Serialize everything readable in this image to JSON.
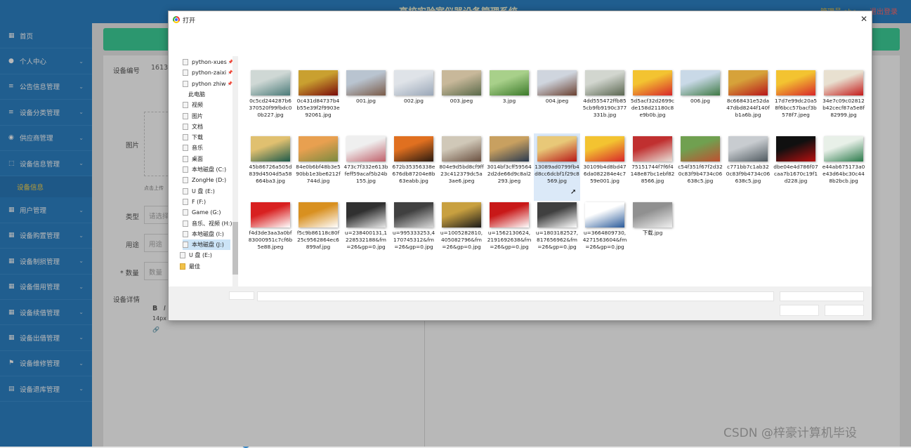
{
  "app": {
    "title": "高校实验室仪器设备管理系统",
    "admin": "管理员 abo",
    "logout": "退出登录"
  },
  "sidebar": {
    "items": [
      {
        "label": "首页",
        "icon": "home-icon"
      },
      {
        "label": "个人中心",
        "icon": "user-icon"
      },
      {
        "label": "公告信息管理",
        "icon": "list-icon"
      },
      {
        "label": "设备分类管理",
        "icon": "list-icon"
      },
      {
        "label": "供应商管理",
        "icon": "circle-icon"
      },
      {
        "label": "设备信息管理",
        "icon": "dashed-square-icon"
      }
    ],
    "sub_item": "设备信息",
    "items2": [
      {
        "label": "用户管理",
        "icon": "grid-icon"
      },
      {
        "label": "设备购置管理",
        "icon": "grid-icon"
      },
      {
        "label": "设备制损管理",
        "icon": "grid-icon"
      },
      {
        "label": "设备借用管理",
        "icon": "grid-icon"
      },
      {
        "label": "设备续借管理",
        "icon": "grid-icon"
      },
      {
        "label": "设备出借管理",
        "icon": "grid-icon"
      },
      {
        "label": "设备维修管理",
        "icon": "flag-icon"
      },
      {
        "label": "设备退库管理",
        "icon": "doc-icon"
      }
    ]
  },
  "form": {
    "code_label": "设备编号",
    "code_value": "16139",
    "image_label": "图片",
    "upload_hint": "点击上传",
    "type_label": "类型",
    "type_placeholder": "请选择",
    "use_label": "用途",
    "use_placeholder": "用途",
    "qty_label": "* 数量",
    "qty_placeholder": "数量",
    "detail_label": "设备详情",
    "editor_bold": "B",
    "editor_italic": "I",
    "editor_size": "14px"
  },
  "dialog": {
    "title": "打开",
    "close": "✕",
    "nav": [
      {
        "label": "python-xues",
        "pin": true
      },
      {
        "label": "python-zaixi",
        "pin": true
      },
      {
        "label": "python zhiw",
        "pin": true
      },
      {
        "label": "此电脑",
        "pin": false
      },
      {
        "label": "视频",
        "pin": false
      },
      {
        "label": "图片",
        "pin": false
      },
      {
        "label": "文档",
        "pin": false
      },
      {
        "label": "下载",
        "pin": false
      },
      {
        "label": "音乐",
        "pin": false
      },
      {
        "label": "桌面",
        "pin": false
      },
      {
        "label": "本地磁盘 (C:)",
        "pin": false
      },
      {
        "label": "ZongHe (D:)",
        "pin": false
      },
      {
        "label": "U 盘 (E:)",
        "pin": false
      },
      {
        "label": "F (F:)",
        "pin": false
      },
      {
        "label": "Game (G:)",
        "pin": false
      },
      {
        "label": "音乐、视频 (H:)",
        "pin": false
      },
      {
        "label": "本地磁盘 (I:)",
        "pin": false
      },
      {
        "label": "本地磁盘 (J:)",
        "pin": false
      },
      {
        "label": "U 盘 (E:)",
        "pin": false
      },
      {
        "label": "最佳",
        "pin": false
      }
    ],
    "files": [
      {
        "name": "0c5cd244287b6370520f99fbdc00b227.jpg",
        "colors": [
          "#4a7a78",
          "#cfd8d5"
        ]
      },
      {
        "name": "0c431d84737b4b55e39f2f9903e92061.jpg",
        "colors": [
          "#7a0a0a",
          "#c9a030"
        ]
      },
      {
        "name": "001.jpg",
        "colors": [
          "#7a5b48",
          "#b9c4d0"
        ]
      },
      {
        "name": "002.jpg",
        "colors": [
          "#9aa7b8",
          "#dfe3e8"
        ]
      },
      {
        "name": "003.jpeg",
        "colors": [
          "#5a6a4a",
          "#c8b89a"
        ]
      },
      {
        "name": "3.jpg",
        "colors": [
          "#3c7a2a",
          "#a8d08a"
        ]
      },
      {
        "name": "004.jpeg",
        "colors": [
          "#6a4030",
          "#cfd5de"
        ]
      },
      {
        "name": "4dd555472ffb855cb9fb9190c377331b.jpg",
        "colors": [
          "#5a6650",
          "#d2d6cf"
        ]
      },
      {
        "name": "5d5acf32d2699cde158d21180c8e9b0b.jpg",
        "colors": [
          "#d8262a",
          "#f3c331"
        ]
      },
      {
        "name": "006.jpg",
        "colors": [
          "#3f7a45",
          "#c9d9e7"
        ]
      },
      {
        "name": "8c668431e52da47dbd8244f140fb1a6b.jpg",
        "colors": [
          "#b8151a",
          "#d6a23a"
        ]
      },
      {
        "name": "17d7e99dc20a58f6bcc57bacf3b578f7.jpeg",
        "colors": [
          "#d8262a",
          "#f3c331"
        ]
      },
      {
        "name": "34e7c09c02812b42cecf87a5e8f82999.jpg",
        "colors": [
          "#c41a1a",
          "#e8e0d0"
        ]
      },
      {
        "name": "45b86726a505d839d4504d5a58664ba3.jpg",
        "colors": [
          "#1d5a4a",
          "#e0c070"
        ]
      },
      {
        "name": "84e0b6bf48b3e590bb1e3be6212f744d.jpg",
        "colors": [
          "#7a8a40",
          "#e8a050"
        ]
      },
      {
        "name": "473c7f332e613bfeff59acaf5b24b155.jpg",
        "colors": [
          "#c0606a",
          "#efefef"
        ]
      },
      {
        "name": "672b35356338e676db87204e8b63eabb.jpg",
        "colors": [
          "#2a1a10",
          "#e07020"
        ]
      },
      {
        "name": "804e9d5bd8cf9ff23c412379dc5a3ae6.jpeg",
        "colors": [
          "#6a5040",
          "#d0c8b8"
        ]
      },
      {
        "name": "3014bf3cff595642d2de66d9c8al2293.jpeg",
        "colors": [
          "#2a3a50",
          "#c8a060"
        ]
      },
      {
        "name": "13089ad0799fb4d8cc6dcbf1f29c8569.jpg",
        "colors": [
          "#b81818",
          "#e8c878"
        ]
      },
      {
        "name": "30109b4d8bd476da082284e4c759e001.jpg",
        "colors": [
          "#d8262a",
          "#f3c331"
        ]
      },
      {
        "name": "75151744f7f6f4148e87bc1ebf828566.jpg",
        "colors": [
          "#e8e0d8",
          "#c03030"
        ]
      },
      {
        "name": "c54f351f67f2d320c83f9b4734c06638c5.jpg",
        "colors": [
          "#c05030",
          "#70a050"
        ]
      },
      {
        "name": "c771bb7c1ab320c83f9b4734c06638c5.jpg",
        "colors": [
          "#505a60",
          "#c8ccd0"
        ]
      },
      {
        "name": "dbe04e4d786f07caa7b1670c19f1d228.jpg",
        "colors": [
          "#b81010",
          "#101010"
        ]
      },
      {
        "name": "e44ab675173a0e43d64bc30c448b2bcb.jpg",
        "colors": [
          "#2a7a4a",
          "#e8f0e8"
        ]
      },
      {
        "name": "f4d3de3aa3a0bf83000951c7cf6b5e88.jpeg",
        "colors": [
          "#ffffff",
          "#d82020"
        ]
      },
      {
        "name": "f5c9b86118c80f25c9562864ec6899af.jpg",
        "colors": [
          "#ffffff",
          "#d89020"
        ]
      },
      {
        "name": "u=238400131,1228532188&fm=26&gp=0.jpg",
        "colors": [
          "#e8e8e8",
          "#303030"
        ]
      },
      {
        "name": "u=995333253,4170745312&fm=26&gp=0.jpg",
        "colors": [
          "#d8d8d8",
          "#404040"
        ]
      },
      {
        "name": "u=1005282810,405082796&fm=26&gp=0.jpg",
        "colors": [
          "#1a1a1a",
          "#c8a040"
        ]
      },
      {
        "name": "u=1562130624,2191692638&fm=26&gp=0.jpg",
        "colors": [
          "#ffffff",
          "#c81818"
        ]
      },
      {
        "name": "u=1803182527,817656962&fm=26&gp=0.jpg",
        "colors": [
          "#ffffff",
          "#404040"
        ]
      },
      {
        "name": "u=3664809730,4271563604&fm=26&gp=0.jpg",
        "colors": [
          "#2a5a9a",
          "#ffffff"
        ]
      },
      {
        "name": "下载.jpg",
        "colors": [
          "#f0f0f0",
          "#909090"
        ]
      }
    ],
    "selected_index": 19
  },
  "watermark": "CSDN @梓豪计算机毕设"
}
